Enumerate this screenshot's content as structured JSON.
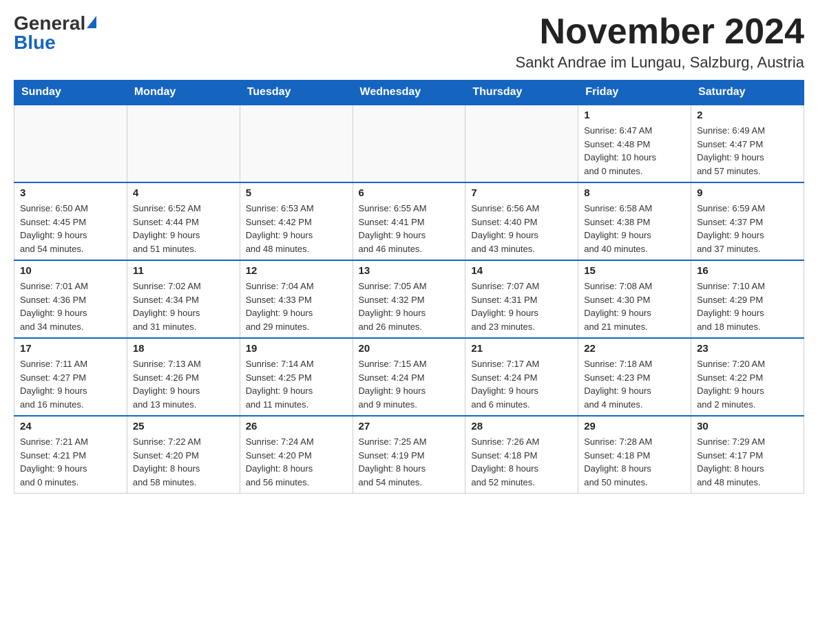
{
  "logo": {
    "general": "General",
    "blue": "Blue"
  },
  "header": {
    "month_year": "November 2024",
    "location": "Sankt Andrae im Lungau, Salzburg, Austria"
  },
  "weekdays": [
    "Sunday",
    "Monday",
    "Tuesday",
    "Wednesday",
    "Thursday",
    "Friday",
    "Saturday"
  ],
  "weeks": [
    [
      {
        "day": "",
        "info": ""
      },
      {
        "day": "",
        "info": ""
      },
      {
        "day": "",
        "info": ""
      },
      {
        "day": "",
        "info": ""
      },
      {
        "day": "",
        "info": ""
      },
      {
        "day": "1",
        "info": "Sunrise: 6:47 AM\nSunset: 4:48 PM\nDaylight: 10 hours\nand 0 minutes."
      },
      {
        "day": "2",
        "info": "Sunrise: 6:49 AM\nSunset: 4:47 PM\nDaylight: 9 hours\nand 57 minutes."
      }
    ],
    [
      {
        "day": "3",
        "info": "Sunrise: 6:50 AM\nSunset: 4:45 PM\nDaylight: 9 hours\nand 54 minutes."
      },
      {
        "day": "4",
        "info": "Sunrise: 6:52 AM\nSunset: 4:44 PM\nDaylight: 9 hours\nand 51 minutes."
      },
      {
        "day": "5",
        "info": "Sunrise: 6:53 AM\nSunset: 4:42 PM\nDaylight: 9 hours\nand 48 minutes."
      },
      {
        "day": "6",
        "info": "Sunrise: 6:55 AM\nSunset: 4:41 PM\nDaylight: 9 hours\nand 46 minutes."
      },
      {
        "day": "7",
        "info": "Sunrise: 6:56 AM\nSunset: 4:40 PM\nDaylight: 9 hours\nand 43 minutes."
      },
      {
        "day": "8",
        "info": "Sunrise: 6:58 AM\nSunset: 4:38 PM\nDaylight: 9 hours\nand 40 minutes."
      },
      {
        "day": "9",
        "info": "Sunrise: 6:59 AM\nSunset: 4:37 PM\nDaylight: 9 hours\nand 37 minutes."
      }
    ],
    [
      {
        "day": "10",
        "info": "Sunrise: 7:01 AM\nSunset: 4:36 PM\nDaylight: 9 hours\nand 34 minutes."
      },
      {
        "day": "11",
        "info": "Sunrise: 7:02 AM\nSunset: 4:34 PM\nDaylight: 9 hours\nand 31 minutes."
      },
      {
        "day": "12",
        "info": "Sunrise: 7:04 AM\nSunset: 4:33 PM\nDaylight: 9 hours\nand 29 minutes."
      },
      {
        "day": "13",
        "info": "Sunrise: 7:05 AM\nSunset: 4:32 PM\nDaylight: 9 hours\nand 26 minutes."
      },
      {
        "day": "14",
        "info": "Sunrise: 7:07 AM\nSunset: 4:31 PM\nDaylight: 9 hours\nand 23 minutes."
      },
      {
        "day": "15",
        "info": "Sunrise: 7:08 AM\nSunset: 4:30 PM\nDaylight: 9 hours\nand 21 minutes."
      },
      {
        "day": "16",
        "info": "Sunrise: 7:10 AM\nSunset: 4:29 PM\nDaylight: 9 hours\nand 18 minutes."
      }
    ],
    [
      {
        "day": "17",
        "info": "Sunrise: 7:11 AM\nSunset: 4:27 PM\nDaylight: 9 hours\nand 16 minutes."
      },
      {
        "day": "18",
        "info": "Sunrise: 7:13 AM\nSunset: 4:26 PM\nDaylight: 9 hours\nand 13 minutes."
      },
      {
        "day": "19",
        "info": "Sunrise: 7:14 AM\nSunset: 4:25 PM\nDaylight: 9 hours\nand 11 minutes."
      },
      {
        "day": "20",
        "info": "Sunrise: 7:15 AM\nSunset: 4:24 PM\nDaylight: 9 hours\nand 9 minutes."
      },
      {
        "day": "21",
        "info": "Sunrise: 7:17 AM\nSunset: 4:24 PM\nDaylight: 9 hours\nand 6 minutes."
      },
      {
        "day": "22",
        "info": "Sunrise: 7:18 AM\nSunset: 4:23 PM\nDaylight: 9 hours\nand 4 minutes."
      },
      {
        "day": "23",
        "info": "Sunrise: 7:20 AM\nSunset: 4:22 PM\nDaylight: 9 hours\nand 2 minutes."
      }
    ],
    [
      {
        "day": "24",
        "info": "Sunrise: 7:21 AM\nSunset: 4:21 PM\nDaylight: 9 hours\nand 0 minutes."
      },
      {
        "day": "25",
        "info": "Sunrise: 7:22 AM\nSunset: 4:20 PM\nDaylight: 8 hours\nand 58 minutes."
      },
      {
        "day": "26",
        "info": "Sunrise: 7:24 AM\nSunset: 4:20 PM\nDaylight: 8 hours\nand 56 minutes."
      },
      {
        "day": "27",
        "info": "Sunrise: 7:25 AM\nSunset: 4:19 PM\nDaylight: 8 hours\nand 54 minutes."
      },
      {
        "day": "28",
        "info": "Sunrise: 7:26 AM\nSunset: 4:18 PM\nDaylight: 8 hours\nand 52 minutes."
      },
      {
        "day": "29",
        "info": "Sunrise: 7:28 AM\nSunset: 4:18 PM\nDaylight: 8 hours\nand 50 minutes."
      },
      {
        "day": "30",
        "info": "Sunrise: 7:29 AM\nSunset: 4:17 PM\nDaylight: 8 hours\nand 48 minutes."
      }
    ]
  ]
}
